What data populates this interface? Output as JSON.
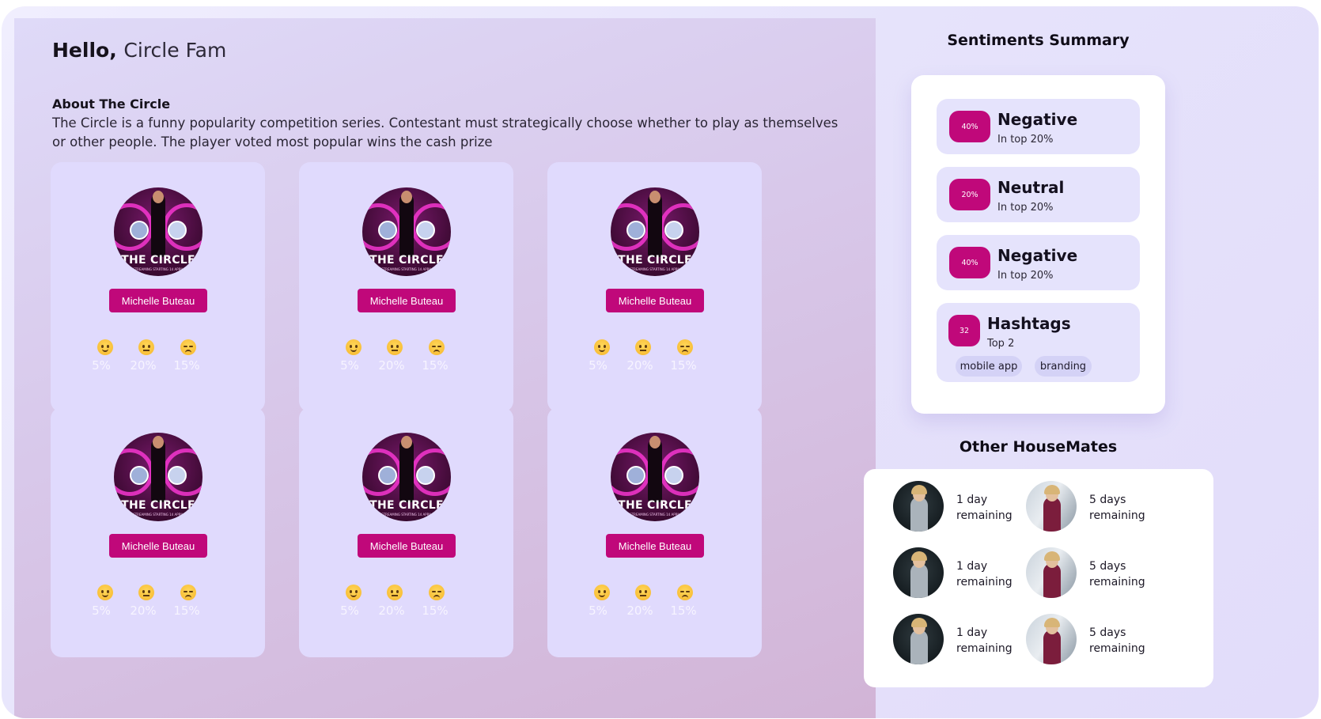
{
  "header": {
    "greeting_bold": "Hello,",
    "greeting_name": "Circle Fam"
  },
  "about": {
    "title": "About The Circle",
    "text": "The Circle is a funny popularity competition series. Contestant must strategically choose whether to play as themselves or other people. The player voted most popular wins the cash prize"
  },
  "cards": [
    {
      "poster_title": "THE CIRCLE",
      "poster_subtitle": "STREAMING STARTING 14 APRIL",
      "name": "Michelle Buteau",
      "emojis": [
        {
          "icon": "slightly-smiling-face-icon",
          "pct": "5%"
        },
        {
          "icon": "neutral-face-icon",
          "pct": "20%"
        },
        {
          "icon": "unamused-face-icon",
          "pct": "15%"
        }
      ]
    },
    {
      "poster_title": "THE CIRCLE",
      "poster_subtitle": "STREAMING STARTING 14 APRIL",
      "name": "Michelle Buteau",
      "emojis": [
        {
          "icon": "slightly-smiling-face-icon",
          "pct": "5%"
        },
        {
          "icon": "neutral-face-icon",
          "pct": "20%"
        },
        {
          "icon": "unamused-face-icon",
          "pct": "15%"
        }
      ]
    },
    {
      "poster_title": "THE CIRCLE",
      "poster_subtitle": "STREAMING STARTING 14 APRIL",
      "name": "Michelle Buteau",
      "emojis": [
        {
          "icon": "slightly-smiling-face-icon",
          "pct": "5%"
        },
        {
          "icon": "neutral-face-icon",
          "pct": "20%"
        },
        {
          "icon": "unamused-face-icon",
          "pct": "15%"
        }
      ]
    },
    {
      "poster_title": "THE CIRCLE",
      "poster_subtitle": "STREAMING STARTING 14 APRIL",
      "name": "Michelle Buteau",
      "emojis": [
        {
          "icon": "slightly-smiling-face-icon",
          "pct": "5%"
        },
        {
          "icon": "neutral-face-icon",
          "pct": "20%"
        },
        {
          "icon": "unamused-face-icon",
          "pct": "15%"
        }
      ]
    },
    {
      "poster_title": "THE CIRCLE",
      "poster_subtitle": "STREAMING STARTING 14 APRIL",
      "name": "Michelle Buteau",
      "emojis": [
        {
          "icon": "slightly-smiling-face-icon",
          "pct": "5%"
        },
        {
          "icon": "neutral-face-icon",
          "pct": "20%"
        },
        {
          "icon": "unamused-face-icon",
          "pct": "15%"
        }
      ]
    },
    {
      "poster_title": "THE CIRCLE",
      "poster_subtitle": "STREAMING STARTING 14 APRIL",
      "name": "Michelle Buteau",
      "emojis": [
        {
          "icon": "slightly-smiling-face-icon",
          "pct": "5%"
        },
        {
          "icon": "neutral-face-icon",
          "pct": "20%"
        },
        {
          "icon": "unamused-face-icon",
          "pct": "15%"
        }
      ]
    }
  ],
  "sentiments": {
    "title": "Sentiments Summary",
    "items": [
      {
        "badge": "40%",
        "label": "Negative",
        "sub": "In top 20%"
      },
      {
        "badge": "20%",
        "label": "Neutral",
        "sub": "In top 20%"
      },
      {
        "badge": "40%",
        "label": "Negative",
        "sub": "In top 20%"
      },
      {
        "badge": "32",
        "label": "Hashtags",
        "sub": "Top 2",
        "tags": [
          "mobile app",
          "branding"
        ]
      }
    ]
  },
  "housemates": {
    "title": "Other HouseMates",
    "items": [
      {
        "line1": "1 day",
        "line2": "remaining"
      },
      {
        "line1": "5 days",
        "line2": "remaining"
      },
      {
        "line1": "1 day",
        "line2": "remaining"
      },
      {
        "line1": "5 days",
        "line2": "remaining"
      },
      {
        "line1": "1 day",
        "line2": "remaining"
      },
      {
        "line1": "5 days",
        "line2": "remaining"
      }
    ]
  },
  "colors": {
    "accent": "#c0087a",
    "card_bg": "#e0dafd",
    "chip_bg": "#d4d2f6"
  }
}
